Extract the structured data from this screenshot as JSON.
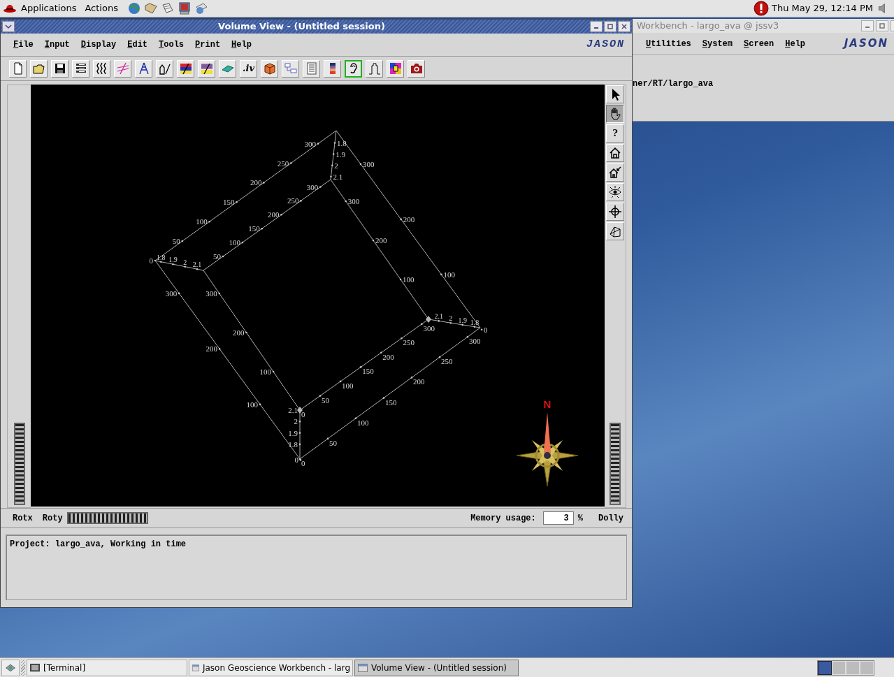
{
  "top_panel": {
    "menus": [
      "Applications",
      "Actions"
    ],
    "clock": "Thu May 29, 12:14 PM"
  },
  "back_window": {
    "title": "Workbench - largo_ava @ jssv3",
    "menus": [
      "Utilities",
      "System",
      "Screen",
      "Help"
    ],
    "logo": "JASON",
    "path": "ner/RT/largo_ava"
  },
  "window": {
    "title": "Volume View - (Untitled session)",
    "menus": [
      "File",
      "Input",
      "Display",
      "Edit",
      "Tools",
      "Print",
      "Help"
    ],
    "logo": "JASON",
    "toolbar": [
      {
        "selected": false
      },
      {
        "selected": false
      },
      {
        "selected": false
      },
      {
        "selected": false
      },
      {
        "selected": false
      },
      {
        "selected": false
      },
      {
        "selected": false
      },
      {
        "selected": false
      },
      {
        "selected": false
      },
      {
        "selected": false
      },
      {
        "selected": false
      },
      {
        "label": ".iv",
        "selected": false
      },
      {
        "selected": false
      },
      {
        "selected": false
      },
      {
        "selected": false
      },
      {
        "selected": false
      },
      {
        "selected": true
      },
      {
        "selected": false
      },
      {
        "selected": false
      },
      {
        "selected": false
      }
    ],
    "view_tools": [
      {
        "selected": false
      },
      {
        "selected": true
      },
      {
        "label": "?",
        "selected": false
      },
      {
        "selected": false
      },
      {
        "selected": false
      },
      {
        "selected": false
      },
      {
        "selected": false
      },
      {
        "selected": false
      }
    ],
    "scene": {
      "edges": [
        {
          "labels": [
            "0",
            "50",
            "100",
            "150",
            "200",
            "250",
            "300"
          ]
        },
        {
          "labels": [
            "50",
            "100",
            "150",
            "200",
            "250",
            "300"
          ]
        },
        {
          "labels": [
            "1.8",
            "1.9",
            "2",
            "2.1"
          ]
        },
        {
          "labels": [
            "1.8",
            "1.9",
            "2",
            "2.1"
          ]
        },
        {
          "labels": [
            "300",
            "200",
            "100",
            "0"
          ]
        },
        {
          "labels": [
            "300",
            "200",
            "100"
          ]
        },
        {
          "labels": [
            "300",
            "200",
            "100",
            "0"
          ]
        },
        {
          "labels": [
            "300",
            "200",
            "100"
          ]
        },
        {
          "labels": [
            "0",
            "50",
            "100",
            "150",
            "200",
            "250",
            "300"
          ]
        },
        {
          "labels": [
            "0",
            "50",
            "100",
            "150",
            "200",
            "250",
            "300"
          ]
        },
        {
          "labels": [
            "2.1",
            "2",
            "1.9",
            "1.8"
          ]
        },
        {
          "labels": [
            "2.1",
            "2",
            "1.9",
            "1.8"
          ]
        }
      ],
      "north": "N"
    },
    "controls": {
      "rotx": "Rotx",
      "roty": "Roty",
      "memory_label": "Memory usage:",
      "memory_value": "3",
      "memory_unit": "%",
      "dolly": "Dolly"
    },
    "message": "Project: largo_ava, Working in time"
  },
  "taskbar": {
    "tasks": [
      {
        "label": "[Terminal]",
        "selected": false
      },
      {
        "label": "Jason Geoscience Workbench - larg",
        "selected": false
      },
      {
        "label": "Volume View - (Untitled session)",
        "selected": true
      }
    ],
    "workspaces": [
      {
        "selected": true
      },
      {
        "selected": false
      },
      {
        "selected": false
      },
      {
        "selected": false
      }
    ]
  }
}
